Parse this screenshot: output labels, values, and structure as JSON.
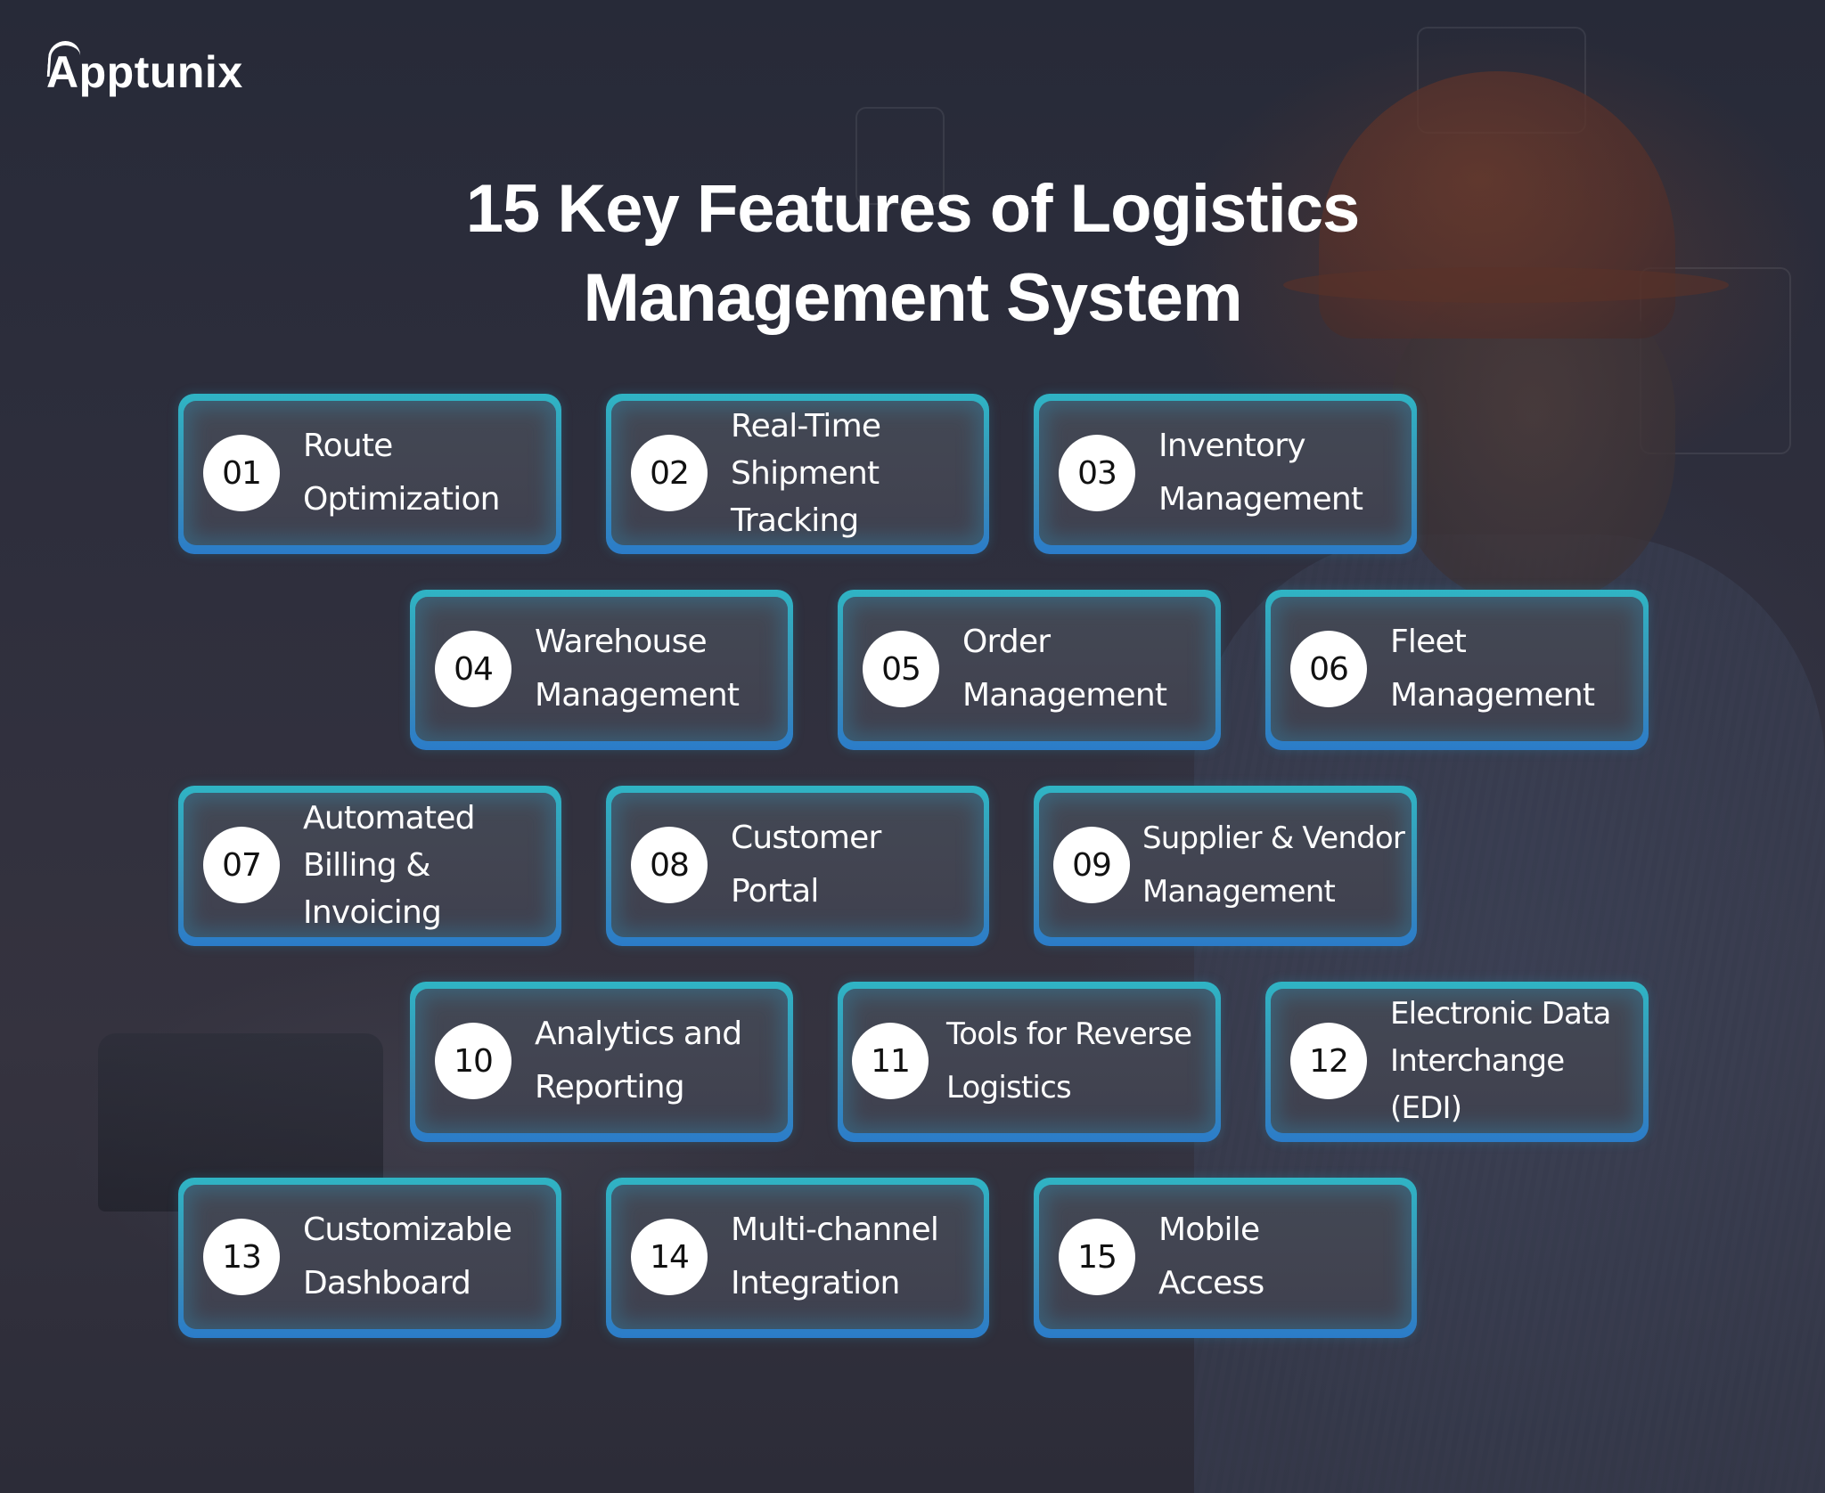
{
  "brand": {
    "name": "Apptunix",
    "accent_color": "#2fb4c4",
    "glow_bottom_color": "#2b7cc9"
  },
  "title": {
    "line1": "15 Key Features of Logistics",
    "line2": "Management System"
  },
  "features": [
    {
      "number": "01",
      "label": "Route\nOptimization"
    },
    {
      "number": "02",
      "label": "Real-Time\nShipment\nTracking"
    },
    {
      "number": "03",
      "label": "Inventory\nManagement"
    },
    {
      "number": "04",
      "label": "Warehouse\nManagement"
    },
    {
      "number": "05",
      "label": "Order\nManagement"
    },
    {
      "number": "06",
      "label": "Fleet\nManagement"
    },
    {
      "number": "07",
      "label": "Automated\nBilling &\nInvoicing"
    },
    {
      "number": "08",
      "label": "Customer\nPortal"
    },
    {
      "number": "09",
      "label": "Supplier & Vendor\nManagement"
    },
    {
      "number": "10",
      "label": "Analytics and\nReporting"
    },
    {
      "number": "11",
      "label": "Tools for Reverse\nLogistics"
    },
    {
      "number": "12",
      "label": "Electronic Data\nInterchange\n(EDI)"
    },
    {
      "number": "13",
      "label": "Customizable\nDashboard"
    },
    {
      "number": "14",
      "label": "Multi-channel\nIntegration"
    },
    {
      "number": "15",
      "label": "Mobile\nAccess"
    }
  ]
}
